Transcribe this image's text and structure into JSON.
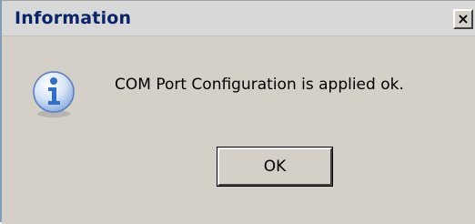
{
  "window": {
    "title": "Information",
    "close_glyph": "×"
  },
  "dialog": {
    "icon": "information-icon",
    "message": "COM Port Configuration is applied ok.",
    "ok_label": "OK"
  },
  "colors": {
    "title_text": "#0a246a",
    "background": "#d4d0c8",
    "icon_blue": "#2f6fd0"
  }
}
